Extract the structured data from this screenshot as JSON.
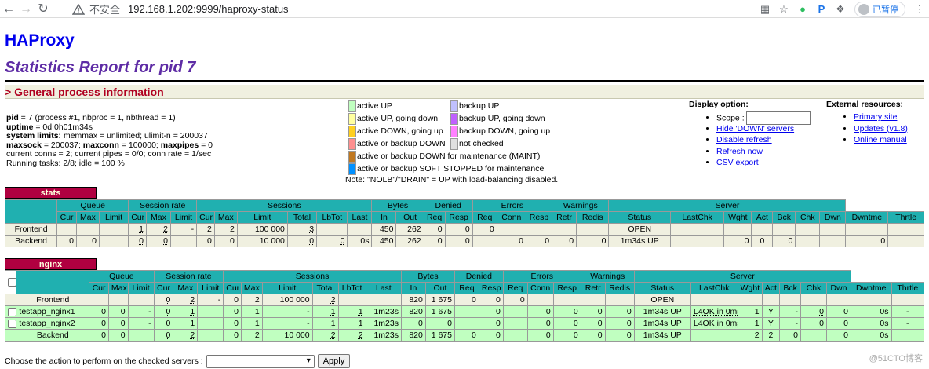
{
  "browser": {
    "unsafe_label": "不安全",
    "url": "192.168.1.202:9999/haproxy-status",
    "paused_label": "已暂停"
  },
  "page": {
    "title": "HAProxy",
    "subtitle": "Statistics Report for pid 7",
    "section_title": "> General process information"
  },
  "process": {
    "pid_label": "pid",
    "pid_value": " = 7 (process #1, nbproc = 1, nbthread = 1)",
    "uptime_label": "uptime",
    "uptime_value": " = 0d 0h01m34s",
    "limits_label": "system limits:",
    "limits_value": " memmax = unlimited; ulimit-n = 200037",
    "maxsock_label": "maxsock",
    "maxsock_value": " = 200037; ",
    "maxconn_label": "maxconn",
    "maxconn_value": " = 100000; ",
    "maxpipes_label": "maxpipes",
    "maxpipes_value": " = 0",
    "conns": "current conns = 2; current pipes = 0/0; conn rate = 1/sec",
    "tasks": "Running tasks: 2/8; idle = 100 %"
  },
  "legend": {
    "left": [
      {
        "label": "active UP",
        "color": "#c0ffc0"
      },
      {
        "label": "active UP, going down",
        "color": "#ffffa0"
      },
      {
        "label": "active DOWN, going up",
        "color": "#ffd020"
      },
      {
        "label": "active or backup DOWN",
        "color": "#ff9090"
      },
      {
        "label": "active or backup DOWN for maintenance (MAINT)",
        "color": "#c07820"
      },
      {
        "label": "active or backup SOFT STOPPED for maintenance",
        "color": "#0090ff"
      }
    ],
    "right": [
      {
        "label": "backup UP",
        "color": "#c0c0ff"
      },
      {
        "label": "backup UP, going down",
        "color": "#c060ff"
      },
      {
        "label": "backup DOWN, going up",
        "color": "#ff80ff"
      },
      {
        "label": "not checked",
        "color": "#e0e0e0"
      }
    ],
    "note": "Note: \"NOLB\"/\"DRAIN\" = UP with load-balancing disabled."
  },
  "display_options": {
    "title": "Display option:",
    "scope_label": "Scope :",
    "links": [
      "Hide 'DOWN' servers",
      "Disable refresh",
      "Refresh now",
      "CSV export"
    ]
  },
  "external": {
    "title": "External resources:",
    "links": [
      "Primary site",
      "Updates (v1.8)",
      "Online manual"
    ]
  },
  "stats": {
    "name": "stats",
    "frontend": {
      "name": "Frontend",
      "q_cur": "",
      "q_max": "",
      "q_lim": "",
      "s_cur": "1",
      "s_max": "2",
      "s_lim": "-",
      "ss_cur": "2",
      "ss_max": "2",
      "ss_lim": "100 000",
      "ss_tot": "3",
      "lbtot": "",
      "last": "",
      "b_in": "450",
      "b_out": "262",
      "dr_req": "0",
      "dr_resp": "0",
      "e_req": "0",
      "e_conn": "",
      "e_resp": "",
      "w_retr": "",
      "w_redis": "",
      "status": "OPEN",
      "lastchk": "",
      "wght": "",
      "act": "",
      "bck": "",
      "chk": "",
      "dwn": "",
      "dwntme": "",
      "thrtle": ""
    },
    "backend": {
      "name": "Backend",
      "q_cur": "0",
      "q_max": "0",
      "q_lim": "",
      "s_cur": "0",
      "s_max": "0",
      "s_lim": "",
      "ss_cur": "0",
      "ss_max": "0",
      "ss_lim": "10 000",
      "ss_tot": "0",
      "lbtot": "0",
      "last": "0s",
      "b_in": "450",
      "b_out": "262",
      "dr_req": "0",
      "dr_resp": "0",
      "e_req": "",
      "e_conn": "0",
      "e_resp": "0",
      "w_retr": "0",
      "w_redis": "0",
      "status": "1m34s UP",
      "lastchk": "",
      "wght": "0",
      "act": "0",
      "bck": "0",
      "chk": "",
      "dwn": "",
      "dwntme": "0",
      "thrtle": ""
    }
  },
  "nginx": {
    "name": "nginx",
    "frontend": {
      "name": "Frontend",
      "q_cur": "",
      "q_max": "",
      "q_lim": "",
      "s_cur": "0",
      "s_max": "2",
      "s_lim": "-",
      "ss_cur": "0",
      "ss_max": "2",
      "ss_lim": "100 000",
      "ss_tot": "2",
      "lbtot": "",
      "last": "",
      "b_in": "820",
      "b_out": "1 675",
      "dr_req": "0",
      "dr_resp": "0",
      "e_req": "0",
      "e_conn": "",
      "e_resp": "",
      "w_retr": "",
      "w_redis": "",
      "status": "OPEN",
      "lastchk": "",
      "wght": "",
      "act": "",
      "bck": "",
      "chk": "",
      "dwn": "",
      "dwntme": "",
      "thrtle": ""
    },
    "servers": [
      {
        "name": "testapp_nginx1",
        "q_cur": "0",
        "q_max": "0",
        "q_lim": "-",
        "s_cur": "0",
        "s_max": "1",
        "s_lim": "",
        "ss_cur": "0",
        "ss_max": "1",
        "ss_lim": "-",
        "ss_tot": "1",
        "lbtot": "1",
        "last": "1m23s",
        "b_in": "820",
        "b_out": "1 675",
        "dr_req": "",
        "dr_resp": "0",
        "e_req": "",
        "e_conn": "0",
        "e_resp": "0",
        "w_retr": "0",
        "w_redis": "0",
        "status": "1m34s UP",
        "lastchk": "L4OK in 0ms",
        "wght": "1",
        "act": "Y",
        "bck": "-",
        "chk": "0",
        "dwn": "0",
        "dwntme": "0s",
        "thrtle": "-"
      },
      {
        "name": "testapp_nginx2",
        "q_cur": "0",
        "q_max": "0",
        "q_lim": "-",
        "s_cur": "0",
        "s_max": "1",
        "s_lim": "",
        "ss_cur": "0",
        "ss_max": "1",
        "ss_lim": "-",
        "ss_tot": "1",
        "lbtot": "1",
        "last": "1m23s",
        "b_in": "0",
        "b_out": "0",
        "dr_req": "",
        "dr_resp": "0",
        "e_req": "",
        "e_conn": "0",
        "e_resp": "0",
        "w_retr": "0",
        "w_redis": "0",
        "status": "1m34s UP",
        "lastchk": "L4OK in 0ms",
        "wght": "1",
        "act": "Y",
        "bck": "-",
        "chk": "0",
        "dwn": "0",
        "dwntme": "0s",
        "thrtle": "-"
      }
    ],
    "backend": {
      "name": "Backend",
      "q_cur": "0",
      "q_max": "0",
      "q_lim": "",
      "s_cur": "0",
      "s_max": "2",
      "s_lim": "",
      "ss_cur": "0",
      "ss_max": "2",
      "ss_lim": "10 000",
      "ss_tot": "2",
      "lbtot": "2",
      "last": "1m23s",
      "b_in": "820",
      "b_out": "1 675",
      "dr_req": "0",
      "dr_resp": "0",
      "e_req": "",
      "e_conn": "0",
      "e_resp": "0",
      "w_retr": "0",
      "w_redis": "0",
      "status": "1m34s UP",
      "lastchk": "",
      "wght": "2",
      "act": "2",
      "bck": "0",
      "chk": "",
      "dwn": "0",
      "dwntme": "0s",
      "thrtle": ""
    }
  },
  "headers": {
    "groups": [
      "Queue",
      "Session rate",
      "Sessions",
      "Bytes",
      "Denied",
      "Errors",
      "Warnings",
      "Server"
    ],
    "sub": [
      "Cur",
      "Max",
      "Limit",
      "Cur",
      "Max",
      "Limit",
      "Cur",
      "Max",
      "Limit",
      "Total",
      "LbTot",
      "Last",
      "In",
      "Out",
      "Req",
      "Resp",
      "Req",
      "Conn",
      "Resp",
      "Retr",
      "Redis",
      "Status",
      "LastChk",
      "Wght",
      "Act",
      "Bck",
      "Chk",
      "Dwn",
      "Dwntme",
      "Thrtle"
    ]
  },
  "action": {
    "label": "Choose the action to perform on the checked servers :",
    "apply": "Apply"
  },
  "watermark": "@51CTO博客"
}
